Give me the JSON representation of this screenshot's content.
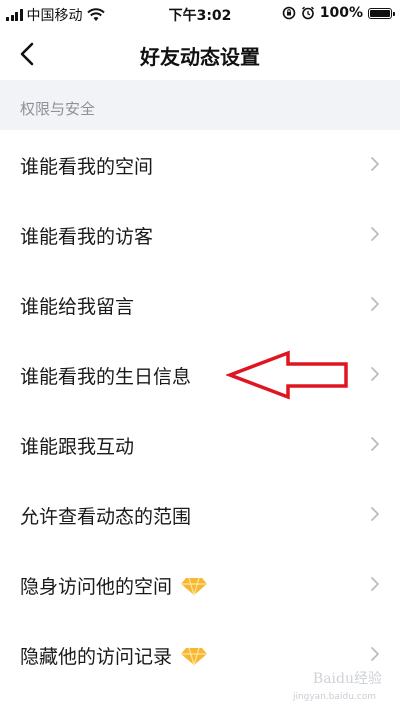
{
  "status_bar": {
    "carrier": "中国移动",
    "time": "下午3:02",
    "battery": "100%",
    "battery_level": 1.0
  },
  "nav": {
    "title": "好友动态设置",
    "back_icon": "chevron-left-icon"
  },
  "section": {
    "title": "权限与安全"
  },
  "items": [
    {
      "label": "谁能看我的空间"
    },
    {
      "label": "谁能看我的访客"
    },
    {
      "label": "谁能给我留言"
    },
    {
      "label": "谁能看我的生日信息"
    },
    {
      "label": "谁能跟我互动"
    },
    {
      "label": "允许查看动态的范围"
    },
    {
      "label": "隐身访问他的空间",
      "badge": "diamond-icon"
    },
    {
      "label": "隐藏他的访问记录",
      "badge": "diamond-icon"
    }
  ],
  "watermark": {
    "text": "Baidu经验",
    "sub": "jingyan.baidu.com"
  },
  "colors": {
    "annotation_arrow": "#e0151f",
    "section_bg": "#f2f3f6",
    "diamond": "#f7b733"
  }
}
